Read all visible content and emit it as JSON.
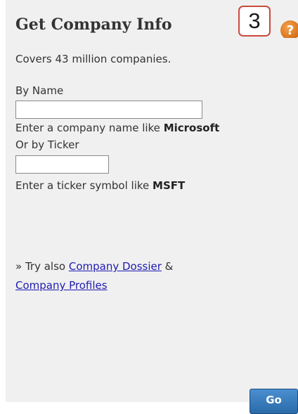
{
  "widget": {
    "title": "Get Company Info",
    "step_number": "3",
    "help_icon": "question-mark-icon",
    "subtitle": "Covers 43 million companies."
  },
  "by_name": {
    "label": "By Name",
    "value": "",
    "placeholder": "",
    "hint_prefix": "Enter a company name like ",
    "hint_example": "Microsoft"
  },
  "by_ticker": {
    "label": "Or by Ticker",
    "value": "",
    "placeholder": "",
    "hint_prefix": "Enter a ticker symbol like ",
    "hint_example": "MSFT"
  },
  "try_also": {
    "prefix": "» Try also ",
    "link1": "Company Dossier",
    "separator": " &",
    "link2": "Company Profiles"
  },
  "go_button": {
    "label": "Go"
  },
  "colors": {
    "panel_background": "#f0f0f0",
    "link": "#1f1bb0",
    "badge_border": "#c84a3c",
    "help_icon": "#e07b22",
    "button": "#2a6aa8"
  }
}
